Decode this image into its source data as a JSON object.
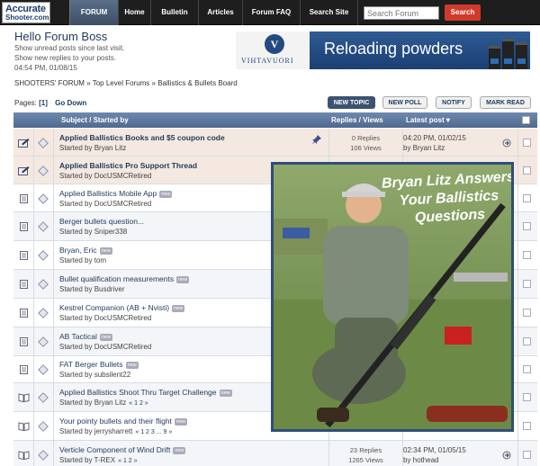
{
  "logo": {
    "line1": "Accurate",
    "line2": "Shooter.com"
  },
  "nav": {
    "items": [
      "FORUM",
      "Home",
      "Bulletin",
      "Articles",
      "Forum FAQ",
      "Search Site"
    ],
    "search_placeholder": "Search Forum",
    "search_button": "Search"
  },
  "greeting": {
    "title": "Hello Forum Boss",
    "line1": "Show unread posts since last visit.",
    "line2": "Show new replies to your posts.",
    "line3": "04:54 PM, 01/08/15"
  },
  "banner": {
    "brand": "VIHTAVUORI",
    "logo_letter": "V",
    "text": "Reloading powders"
  },
  "breadcrumb": "SHOOTERS' FORUM » Top Level Forums » Ballistics & Bullets Board",
  "pagination": {
    "label": "Pages:",
    "current": "[1]",
    "go_down": "Go Down"
  },
  "actions": [
    "NEW TOPIC",
    "NEW POLL",
    "NOTIFY",
    "MARK READ"
  ],
  "table_header": {
    "subject": "Subject / Started by",
    "replies": "Replies / Views",
    "latest": "Latest post ▾"
  },
  "new_badge": "new",
  "topics": [
    {
      "title": "Applied Ballistics Books and $5 coupon code",
      "starter": "Started by Bryan Litz",
      "replies": "0 Replies",
      "views": "106 Views",
      "latest_date": "04:20 PM, 01/02/15",
      "latest_by": "by Bryan Litz",
      "sticky": true,
      "pinned": true
    },
    {
      "title": "Applied Ballistics Pro Support Thread",
      "starter": "Started by DocUSMCRetired",
      "sticky": true
    },
    {
      "title": "Applied Ballistics Mobile App",
      "starter": "Started by DocUSMCRetired",
      "is_new": true
    },
    {
      "title": "Berger bullets question...",
      "starter": "Started by Sniper338"
    },
    {
      "title": "Bryan, Eric",
      "starter": "Started by tom",
      "is_new": true
    },
    {
      "title": "Bullet qualification measurements",
      "starter": "Started by Busdriver",
      "is_new": true
    },
    {
      "title": "Kestrel Companion (AB + Nvisti)",
      "starter": "Started by DocUSMCRetired",
      "is_new": true
    },
    {
      "title": "AB Tactical",
      "starter": "Started by DocUSMCRetired",
      "is_new": true
    },
    {
      "title": "FAT Berger Bullets",
      "starter": "Started by subsilent22",
      "is_new": true
    },
    {
      "title": "Applied Ballistics Shoot Thru Target Challenge",
      "starter": "Started by Bryan Litz",
      "pages": "« 1 2 »",
      "is_new": true
    },
    {
      "title": "Your pointy bullets and their flight",
      "starter": "Started by jerrysharrett",
      "pages": "« 1 2 3 ... 9 »",
      "is_new": true
    },
    {
      "title": "Verticle Component of Wind Drift",
      "starter": "Started by T-REX",
      "pages": "« 1 2 »",
      "replies": "23 Replies",
      "views": "1265 Views",
      "latest_date": "02:34 PM, 01/05/15",
      "latest_by": "by hothead",
      "is_new": true
    }
  ],
  "overlay": {
    "caption": "Bryan Litz Answers Your Ballistics Questions"
  }
}
